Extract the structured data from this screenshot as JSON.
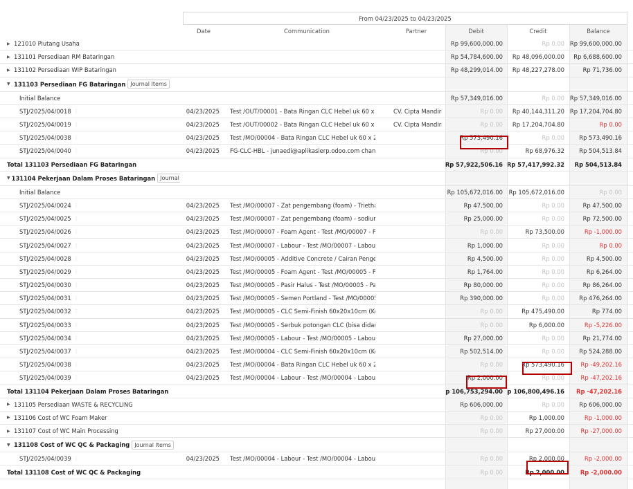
{
  "header": {
    "period": "From 04/23/2025 to 04/23/2025",
    "columns": {
      "date": "Date",
      "communication": "Communication",
      "partner": "Partner",
      "debit": "Debit",
      "credit": "Credit",
      "balance": "Balance"
    }
  },
  "icons": {
    "expand": "caret-right-icon",
    "collapse": "caret-down-icon",
    "kebab": "vertical-dots-icon",
    "ellipsis": "ellipsis-icon"
  },
  "colors": {
    "negative": "#dd3333",
    "highlight": "#b30000",
    "muted": "#c2c2c2"
  },
  "rows": [
    {
      "type": "account",
      "name": "121010 Piutang Usaha",
      "debit": "Rp 99,600,000.00",
      "credit": "Rp 0.00",
      "balance": "Rp 99,600,000.00"
    },
    {
      "type": "account",
      "name": "131101 Persediaan RM Bataringan",
      "debit": "Rp 54,784,600.00",
      "credit": "Rp 48,096,000.00",
      "balance": "Rp 6,688,600.00"
    },
    {
      "type": "account",
      "name": "131102 Persediaan WIP Bataringan",
      "debit": "Rp 48,299,014.00",
      "credit": "Rp 48,227,278.00",
      "balance": "Rp 71,736.00"
    },
    {
      "type": "open",
      "name": "131103 Persediaan FG Bataringan",
      "tag": "Journal Items"
    },
    {
      "type": "init",
      "name": "Initial Balance",
      "debit": "Rp 57,349,016.00",
      "credit": "Rp 0.00",
      "balance": "Rp 57,349,016.00"
    },
    {
      "type": "line",
      "name": "STJ/2025/04/0018",
      "date": "04/23/2025",
      "comm": "Test /OUT/00001 - Bata Ringan CLC Hebel uk 60 x 20",
      "partner": "CV. Cipta Mandiri",
      "debit": "Rp 0.00",
      "credit": "Rp 40,144,311.20",
      "balance": "Rp 17,204,704.80"
    },
    {
      "type": "line",
      "name": "STJ/2025/04/0019",
      "date": "04/23/2025",
      "comm": "Test /OUT/00002 - Bata Ringan CLC Hebel uk 60 x 20",
      "partner": "CV. Cipta Mandiri",
      "debit": "Rp 0.00",
      "credit": "Rp 17,204,704.80",
      "balance": "Rp 0.00"
    },
    {
      "type": "line",
      "name": "STJ/2025/04/0038",
      "date": "04/23/2025",
      "comm": "Test /MO/00004 - Bata Ringan CLC Hebel uk 60 x 20",
      "partner": "",
      "debit": "Rp 573,490.16",
      "credit": "Rp 0.00",
      "balance": "Rp 573,490.16"
    },
    {
      "type": "line",
      "name": "STJ/2025/04/0040",
      "date": "04/23/2025",
      "comm": "FG-CLC-HBL - junaedi@aplikasierp.odoo.com changed",
      "partner": "",
      "debit": "Rp 0.00",
      "credit": "Rp 68,976.32",
      "balance": "Rp 504,513.84"
    },
    {
      "type": "total",
      "name": "Total 131103 Persediaan FG Bataringan",
      "debit": "Rp 57,922,506.16",
      "credit": "Rp 57,417,992.32",
      "balance": "Rp 504,513.84"
    },
    {
      "type": "open",
      "name": "131104 Pekerjaan Dalam Proses Bataringan",
      "tag": "Journal Items"
    },
    {
      "type": "init",
      "name": "Initial Balance",
      "debit": "Rp 105,672,016.00",
      "credit": "Rp 105,672,016.00",
      "balance": "Rp 0.00"
    },
    {
      "type": "line",
      "name": "STJ/2025/04/0024",
      "date": "04/23/2025",
      "comm": "Test /MO/00007 - Zat pengembang (foam) - Triethano",
      "partner": "",
      "debit": "Rp 47,500.00",
      "credit": "Rp 0.00",
      "balance": "Rp 47,500.00"
    },
    {
      "type": "line",
      "name": "STJ/2025/04/0025",
      "date": "04/23/2025",
      "comm": "Test /MO/00007 - Zat pengembang (foam) - sodium La",
      "partner": "",
      "debit": "Rp 25,000.00",
      "credit": "Rp 0.00",
      "balance": "Rp 72,500.00"
    },
    {
      "type": "line",
      "name": "STJ/2025/04/0026",
      "date": "04/23/2025",
      "comm": "Test /MO/00007 - Foam Agent - Test /MO/00007 - Foa",
      "partner": "",
      "debit": "Rp 0.00",
      "credit": "Rp 73,500.00",
      "balance": "Rp -1,000.00"
    },
    {
      "type": "line",
      "name": "STJ/2025/04/0027",
      "date": "04/23/2025",
      "comm": "Test /MO/00007 - Labour - Test /MO/00007 - Labour",
      "partner": "",
      "debit": "Rp 1,000.00",
      "credit": "Rp 0.00",
      "balance": "Rp 0.00"
    },
    {
      "type": "line",
      "name": "STJ/2025/04/0028",
      "date": "04/23/2025",
      "comm": "Test /MO/00005 - Additive Concrete / Cairan Penger",
      "partner": "",
      "debit": "Rp 4,500.00",
      "credit": "Rp 0.00",
      "balance": "Rp 4,500.00"
    },
    {
      "type": "line",
      "name": "STJ/2025/04/0029",
      "date": "04/23/2025",
      "comm": "Test /MO/00005 - Foam Agent - Test /MO/00005 - Foa",
      "partner": "",
      "debit": "Rp 1,764.00",
      "credit": "Rp 0.00",
      "balance": "Rp 6,264.00"
    },
    {
      "type": "line",
      "name": "STJ/2025/04/0030",
      "date": "04/23/2025",
      "comm": "Test /MO/00005 - Pasir Halus - Test /MO/00005 - Pa",
      "partner": "",
      "debit": "Rp 80,000.00",
      "credit": "Rp 0.00",
      "balance": "Rp 86,264.00"
    },
    {
      "type": "line",
      "name": "STJ/2025/04/0031",
      "date": "04/23/2025",
      "comm": "Test /MO/00005 - Semen Portland - Test /MO/00005 -",
      "partner": "",
      "debit": "Rp 390,000.00",
      "credit": "Rp 0.00",
      "balance": "Rp 476,264.00"
    },
    {
      "type": "line",
      "name": "STJ/2025/04/0032",
      "date": "04/23/2025",
      "comm": "Test /MO/00005 - CLC Semi-Finish 60x20x10cm (Kerin",
      "partner": "",
      "debit": "Rp 0.00",
      "credit": "Rp 475,490.00",
      "balance": "Rp 774.00"
    },
    {
      "type": "line",
      "name": "STJ/2025/04/0033",
      "date": "04/23/2025",
      "comm": "Test /MO/00005 - Serbuk potongan CLC (bisa didaur",
      "partner": "",
      "debit": "Rp 0.00",
      "credit": "Rp 6,000.00",
      "balance": "Rp -5,226.00"
    },
    {
      "type": "line",
      "name": "STJ/2025/04/0034",
      "date": "04/23/2025",
      "comm": "Test /MO/00005 - Labour - Test /MO/00005 - Labour",
      "partner": "",
      "debit": "Rp 27,000.00",
      "credit": "Rp 0.00",
      "balance": "Rp 21,774.00"
    },
    {
      "type": "line",
      "name": "STJ/2025/04/0037",
      "date": "04/23/2025",
      "comm": "Test /MO/00004 - CLC Semi-Finish 60x20x10cm (Kerin",
      "partner": "",
      "debit": "Rp 502,514.00",
      "credit": "Rp 0.00",
      "balance": "Rp 524,288.00"
    },
    {
      "type": "line",
      "name": "STJ/2025/04/0038",
      "date": "04/23/2025",
      "comm": "Test /MO/00004 - Bata Ringan CLC Hebel uk 60 x 20",
      "partner": "",
      "debit": "Rp 0.00",
      "credit": "Rp 573,490.16",
      "balance": "Rp -49,202.16"
    },
    {
      "type": "line",
      "name": "STJ/2025/04/0039",
      "date": "04/23/2025",
      "comm": "Test /MO/00004 - Labour - Test /MO/00004 - Labour",
      "partner": "",
      "debit": "Rp 2,000.00",
      "credit": "Rp 0.00",
      "balance": "Rp -47,202.16"
    },
    {
      "type": "total",
      "name": "Total 131104 Pekerjaan Dalam Proses Bataringan",
      "debit": "Rp 106,753,294.00",
      "credit": "Rp 106,800,496.16",
      "balance": "Rp -47,202.16"
    },
    {
      "type": "account",
      "name": "131105 Persediaan WASTE & RECYCLING",
      "debit": "Rp 606,000.00",
      "credit": "Rp 0.00",
      "balance": "Rp 606,000.00"
    },
    {
      "type": "account",
      "name": "131106 Cost of WC Foam Maker",
      "debit": "Rp 0.00",
      "credit": "Rp 1,000.00",
      "balance": "Rp -1,000.00"
    },
    {
      "type": "account",
      "name": "131107 Cost of WC Main Processing",
      "debit": "Rp 0.00",
      "credit": "Rp 27,000.00",
      "balance": "Rp -27,000.00"
    },
    {
      "type": "open",
      "name": "131108 Cost of WC QC & Packaging",
      "tag": "Journal Items"
    },
    {
      "type": "line",
      "name": "STJ/2025/04/0039",
      "date": "04/23/2025",
      "comm": "Test /MO/00004 - Labour - Test /MO/00004 - Labour",
      "partner": "",
      "debit": "Rp 0.00",
      "credit": "Rp 2,000.00",
      "balance": "Rp -2,000.00"
    },
    {
      "type": "total",
      "name": "Total 131108 Cost of WC QC & Packaging",
      "debit": "Rp 0.00",
      "credit": "Rp 2,000.00",
      "balance": "Rp -2,000.00"
    }
  ]
}
